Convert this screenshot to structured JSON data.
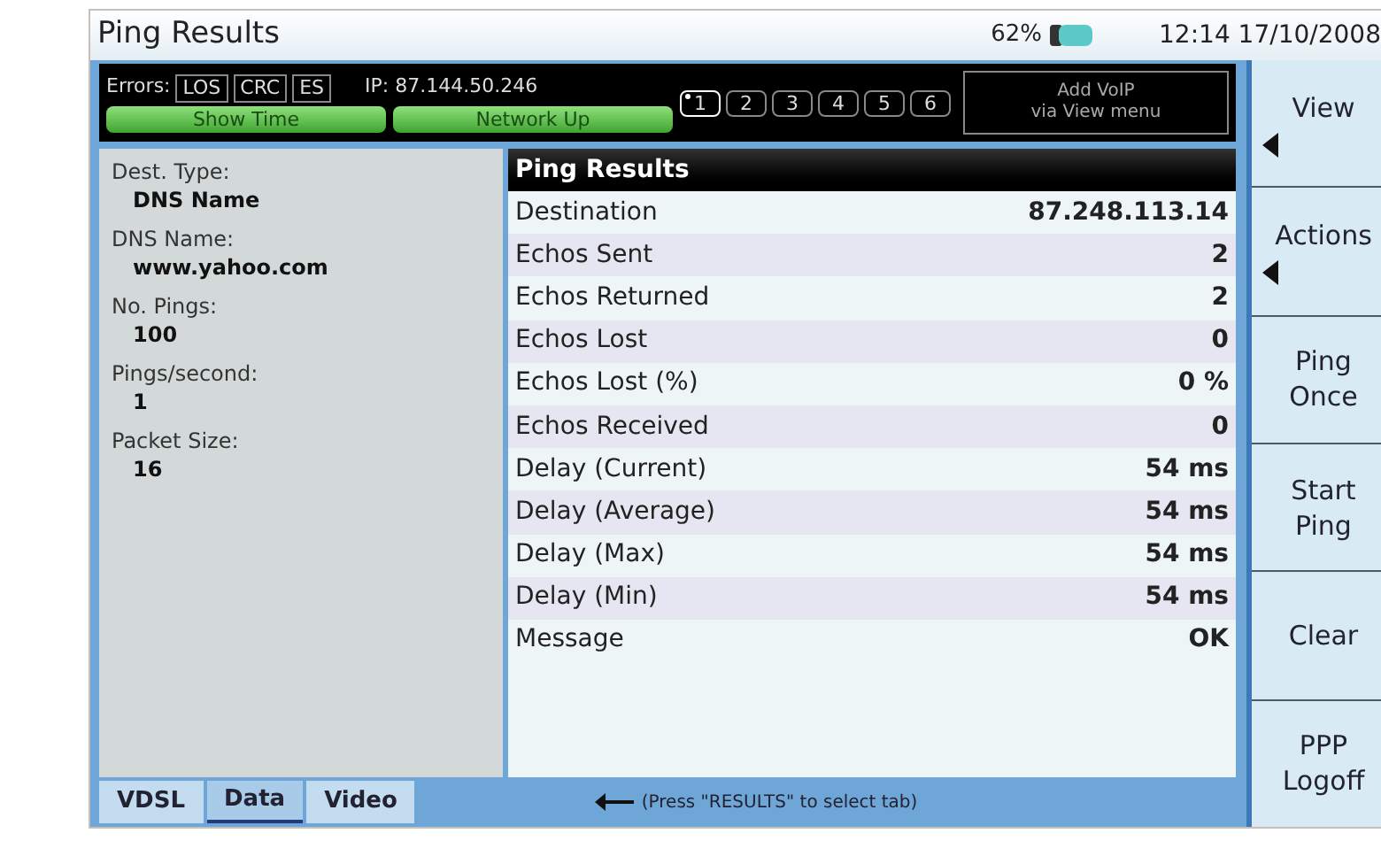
{
  "window": {
    "title": "Ping Results",
    "battery": "62%",
    "clock": "12:14 17/10/2008"
  },
  "status": {
    "errors_label": "Errors:",
    "errors": [
      {
        "label": "LOS",
        "active": false
      },
      {
        "label": "CRC",
        "active": false
      },
      {
        "label": "ES",
        "active": false
      }
    ],
    "ip": "IP: 87.144.50.246",
    "indicators": [
      {
        "label": "Show Time",
        "on": true
      },
      {
        "label": "Network Up",
        "on": true
      }
    ],
    "channels": [
      {
        "label": "1",
        "selected": true
      },
      {
        "label": "2",
        "selected": false
      },
      {
        "label": "3",
        "selected": false
      },
      {
        "label": "4",
        "selected": false
      },
      {
        "label": "5",
        "selected": false
      },
      {
        "label": "6",
        "selected": false
      }
    ],
    "voip_note": [
      "Add VoIP",
      "via View menu"
    ]
  },
  "settings": [
    {
      "label": "Dest. Type:",
      "value": "DNS Name"
    },
    {
      "label": "DNS Name:",
      "value": "www.yahoo.com"
    },
    {
      "label": "No. Pings:",
      "value": "100"
    },
    {
      "label": "Pings/second:",
      "value": "1"
    },
    {
      "label": "Packet Size:",
      "value": "16"
    }
  ],
  "results": {
    "title": "Ping Results",
    "rows": [
      {
        "name": "Destination",
        "value": "87.248.113.14"
      },
      {
        "name": "Echos Sent",
        "value": "2"
      },
      {
        "name": "Echos Returned",
        "value": "2"
      },
      {
        "name": "Echos Lost",
        "value": "0"
      },
      {
        "name": "Echos Lost (%)",
        "value": "0 %"
      },
      {
        "name": "Echos Received",
        "value": "0"
      },
      {
        "name": "Delay (Current)",
        "value": "54 ms"
      },
      {
        "name": "Delay (Average)",
        "value": "54 ms"
      },
      {
        "name": "Delay (Max)",
        "value": "54 ms"
      },
      {
        "name": "Delay (Min)",
        "value": "54 ms"
      },
      {
        "name": "Message",
        "value": "OK"
      }
    ]
  },
  "tabs": [
    {
      "label": "VDSL",
      "selected": false
    },
    {
      "label": "Data",
      "selected": true
    },
    {
      "label": "Video",
      "selected": false
    }
  ],
  "hint": "(Press \"RESULTS\" to select tab)",
  "softkeys": [
    {
      "lines": [
        "View"
      ],
      "submenu": true
    },
    {
      "lines": [
        "Actions"
      ],
      "submenu": true
    },
    {
      "lines": [
        "Ping",
        "Once"
      ],
      "submenu": false
    },
    {
      "lines": [
        "Start",
        "Ping"
      ],
      "submenu": false
    },
    {
      "lines": [
        "Clear"
      ],
      "submenu": false
    },
    {
      "lines": [
        "PPP",
        "Logoff"
      ],
      "submenu": false
    }
  ]
}
